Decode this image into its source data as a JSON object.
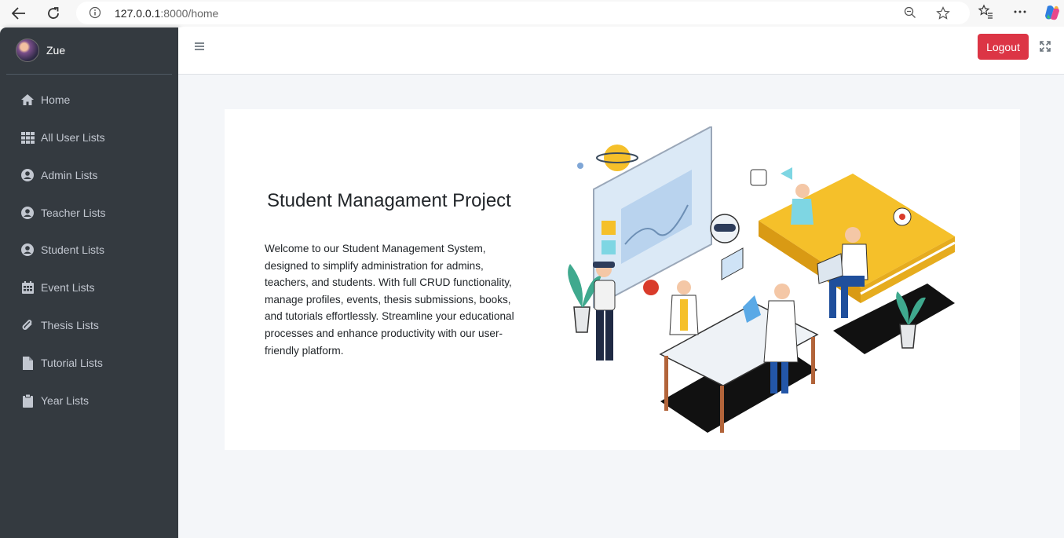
{
  "browser": {
    "url_host": "127.0.0.1",
    "url_rest": ":8000/home"
  },
  "sidebar": {
    "user_name": "Zue",
    "items": [
      {
        "label": "Home",
        "icon": "home-icon"
      },
      {
        "label": "All User Lists",
        "icon": "grid-icon"
      },
      {
        "label": "Admin Lists",
        "icon": "user-circle-icon"
      },
      {
        "label": "Teacher Lists",
        "icon": "user-circle-icon"
      },
      {
        "label": "Student Lists",
        "icon": "user-circle-icon"
      },
      {
        "label": "Event Lists",
        "icon": "calendar-icon"
      },
      {
        "label": "Thesis Lists",
        "icon": "paperclip-icon"
      },
      {
        "label": "Tutorial Lists",
        "icon": "file-icon"
      },
      {
        "label": "Year Lists",
        "icon": "clipboard-icon"
      }
    ]
  },
  "topnav": {
    "logout_label": "Logout"
  },
  "main": {
    "title": "Student Managament Project",
    "description": "Welcome to our Student Management System, designed to simplify administration for admins, teachers, and students. With full CRUD functionality, manage profiles, events, thesis submissions, books, and tutorials effortlessly. Streamline your educational processes and enhance productivity with our user-friendly platform."
  },
  "colors": {
    "sidebar_bg": "#343a40",
    "logout_bg": "#dc3545",
    "content_bg": "#f4f6f9"
  }
}
